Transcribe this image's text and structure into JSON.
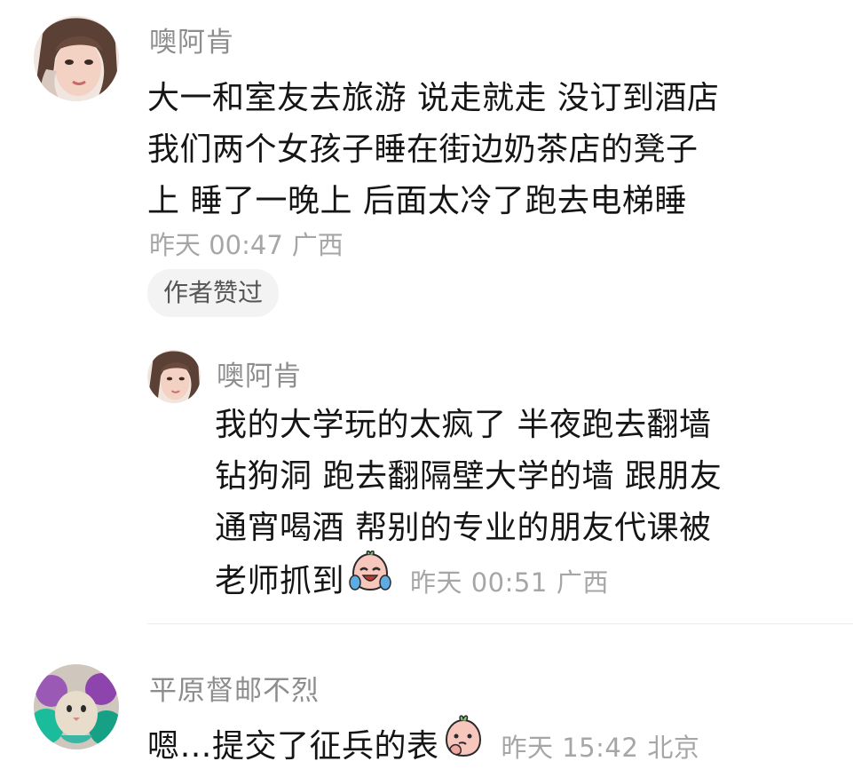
{
  "comments": [
    {
      "username": "噢阿肯",
      "lines": [
        "大一和室友去旅游 说走就走 没订到酒店",
        "我们两个女孩子睡在街边奶茶店的凳子",
        "上 睡了一晚上 后面太冷了跑去电梯睡"
      ],
      "time": "昨天 00:47",
      "location": "广西",
      "badge": "作者赞过",
      "avatar_icon": "girl-portrait-avatar"
    },
    {
      "username": "噢阿肯",
      "lines": [
        "我的大学玩的太疯了 半夜跑去翻墙",
        "钻狗洞 跑去翻隔壁大学的墙 跟朋友",
        "通宵喝酒 帮别的专业的朋友代课被",
        "老师抓到"
      ],
      "emoji": "crying-laughing-emoji",
      "time": "昨天 00:51",
      "location": "广西",
      "avatar_icon": "girl-portrait-avatar"
    },
    {
      "username": "平原督邮不烈",
      "lines": [
        "嗯…提交了征兵的表"
      ],
      "emoji": "thinking-peach-emoji",
      "time": "昨天 15:42",
      "location": "北京",
      "avatar_icon": "fluffy-cat-avatar"
    }
  ],
  "colors": {
    "text": "#151515",
    "name": "#8d8d8d",
    "meta": "#a6a6a6",
    "badge_bg": "#f3f3f3",
    "divider": "#ececec"
  }
}
